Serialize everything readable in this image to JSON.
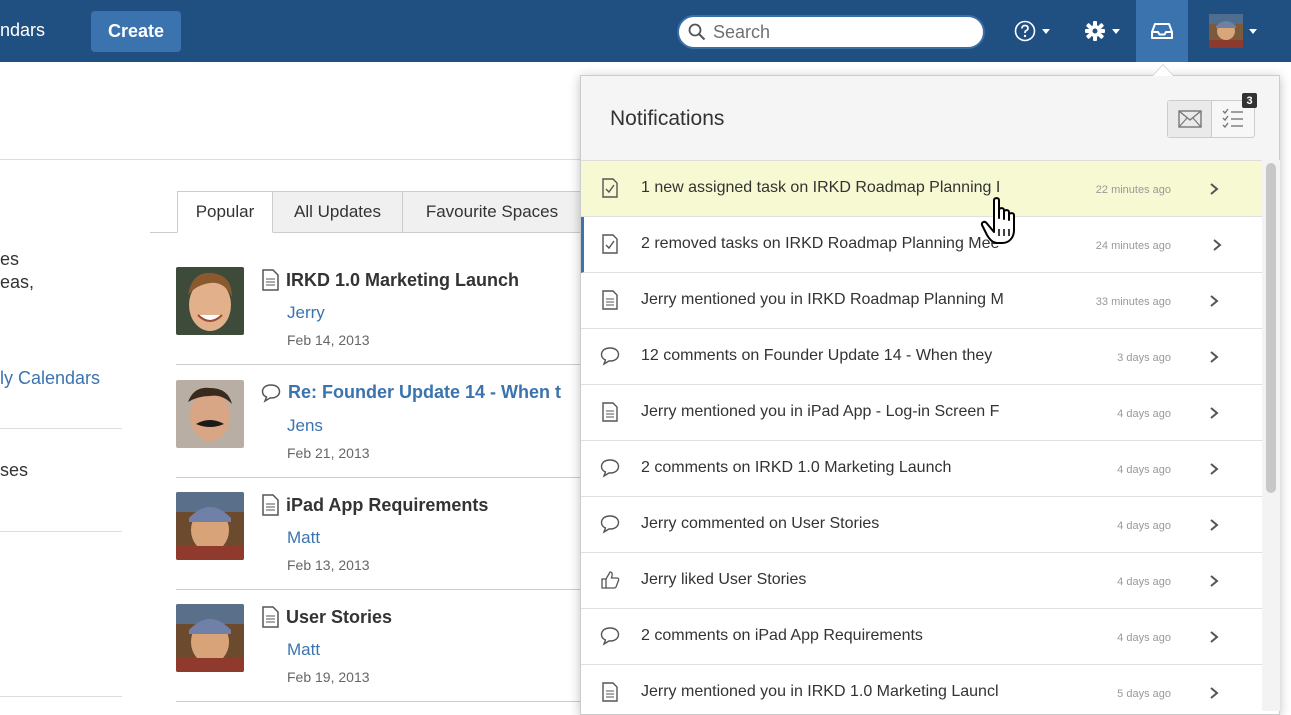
{
  "topnav": {
    "calendars_fragment": "ndars",
    "create_label": "Create",
    "search_placeholder": "Search",
    "brand_color": "#205081",
    "accent_color": "#3b73af"
  },
  "left_fragments": {
    "line1": "es",
    "line2": "eas,",
    "calendars_link": "ly Calendars",
    "spaces": "ses"
  },
  "tabs": [
    {
      "label": "Popular",
      "active": true
    },
    {
      "label": "All Updates",
      "active": false
    },
    {
      "label": "Favourite Spaces",
      "active": false
    }
  ],
  "feed": [
    {
      "title": "IRKD 1.0 Marketing Launch",
      "author": "Jerry",
      "date": "Feb 14, 2013",
      "icon": "page-icon"
    },
    {
      "title": "Re: Founder Update 14 - When t",
      "author": "Jens",
      "date": "Feb 21, 2013",
      "icon": "comment-icon"
    },
    {
      "title": "iPad App Requirements",
      "author": "Matt",
      "date": "Feb 13, 2013",
      "icon": "page-icon"
    },
    {
      "title": "User Stories",
      "author": "Matt",
      "date": "Feb 19, 2013",
      "icon": "page-icon"
    }
  ],
  "notifications": {
    "title": "Notifications",
    "tasks_count": "3",
    "items": [
      {
        "text": "1 new assigned task on IRKD Roadmap Planning I",
        "time": "22 minutes ago",
        "icon": "task-icon",
        "highlighted": true,
        "unread": false
      },
      {
        "text": "2 removed tasks on IRKD Roadmap Planning Mee",
        "time": "24 minutes ago",
        "icon": "task-icon",
        "highlighted": false,
        "unread": true
      },
      {
        "text": "Jerry mentioned you in IRKD Roadmap Planning M",
        "time": "33 minutes ago",
        "icon": "page-icon",
        "highlighted": false,
        "unread": false
      },
      {
        "text": "12 comments on Founder Update 14 - When they",
        "time": "3 days ago",
        "icon": "comment-icon",
        "highlighted": false,
        "unread": false
      },
      {
        "text": "Jerry mentioned you in iPad App - Log-in Screen F",
        "time": "4 days ago",
        "icon": "page-icon",
        "highlighted": false,
        "unread": false
      },
      {
        "text": "2 comments on IRKD 1.0 Marketing Launch",
        "time": "4 days ago",
        "icon": "comment-icon",
        "highlighted": false,
        "unread": false
      },
      {
        "text": "Jerry commented on User Stories",
        "time": "4 days ago",
        "icon": "comment-icon",
        "highlighted": false,
        "unread": false
      },
      {
        "text": "Jerry liked User Stories",
        "time": "4 days ago",
        "icon": "like-icon",
        "highlighted": false,
        "unread": false
      },
      {
        "text": "2 comments on iPad App Requirements",
        "time": "4 days ago",
        "icon": "comment-icon",
        "highlighted": false,
        "unread": false
      },
      {
        "text": "Jerry mentioned you in IRKD 1.0 Marketing Launcl",
        "time": "5 days ago",
        "icon": "page-icon",
        "highlighted": false,
        "unread": false
      }
    ]
  }
}
